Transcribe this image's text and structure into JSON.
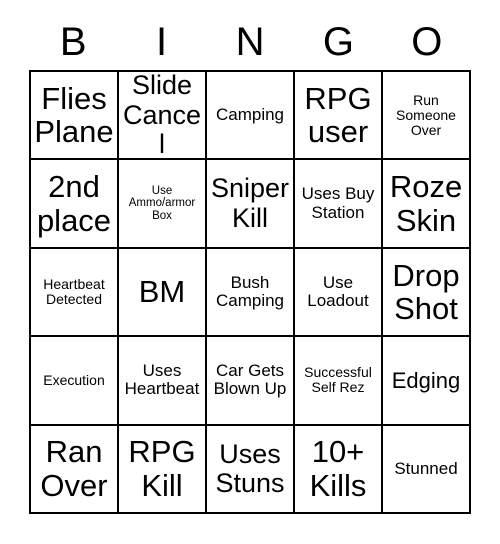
{
  "header": {
    "letters": [
      "B",
      "I",
      "N",
      "G",
      "O"
    ]
  },
  "grid": {
    "rows": [
      [
        {
          "text": "Flies Plane",
          "size": "fs-xl"
        },
        {
          "text": "Slide Cancel",
          "size": "fs-lg"
        },
        {
          "text": "Camping",
          "size": "fs-sm"
        },
        {
          "text": "RPG user",
          "size": "fs-xl"
        },
        {
          "text": "Run Someone Over",
          "size": "fs-xs"
        }
      ],
      [
        {
          "text": "2nd place",
          "size": "fs-xl"
        },
        {
          "text": "Use Ammo/armor Box",
          "size": "fs-xxs"
        },
        {
          "text": "Sniper Kill",
          "size": "fs-lg"
        },
        {
          "text": "Uses Buy Station",
          "size": "fs-sm"
        },
        {
          "text": "Roze Skin",
          "size": "fs-xl"
        }
      ],
      [
        {
          "text": "Heartbeat Detected",
          "size": "fs-xs"
        },
        {
          "text": "BM",
          "size": "fs-xl"
        },
        {
          "text": "Bush Camping",
          "size": "fs-sm"
        },
        {
          "text": "Use Loadout",
          "size": "fs-sm"
        },
        {
          "text": "Drop Shot",
          "size": "fs-xl"
        }
      ],
      [
        {
          "text": "Execution",
          "size": "fs-xs"
        },
        {
          "text": "Uses Heartbeat",
          "size": "fs-sm"
        },
        {
          "text": "Car Gets Blown Up",
          "size": "fs-sm"
        },
        {
          "text": "Successful Self Rez",
          "size": "fs-xs"
        },
        {
          "text": "Edging",
          "size": "fs-md"
        }
      ],
      [
        {
          "text": "Ran Over",
          "size": "fs-xl"
        },
        {
          "text": "RPG Kill",
          "size": "fs-xl"
        },
        {
          "text": "Uses Stuns",
          "size": "fs-lg"
        },
        {
          "text": "10+ Kills",
          "size": "fs-xl"
        },
        {
          "text": "Stunned",
          "size": "fs-sm"
        }
      ]
    ]
  },
  "colors": {
    "background": "#ffffff",
    "grid_line": "#000000",
    "text": "#000000"
  }
}
